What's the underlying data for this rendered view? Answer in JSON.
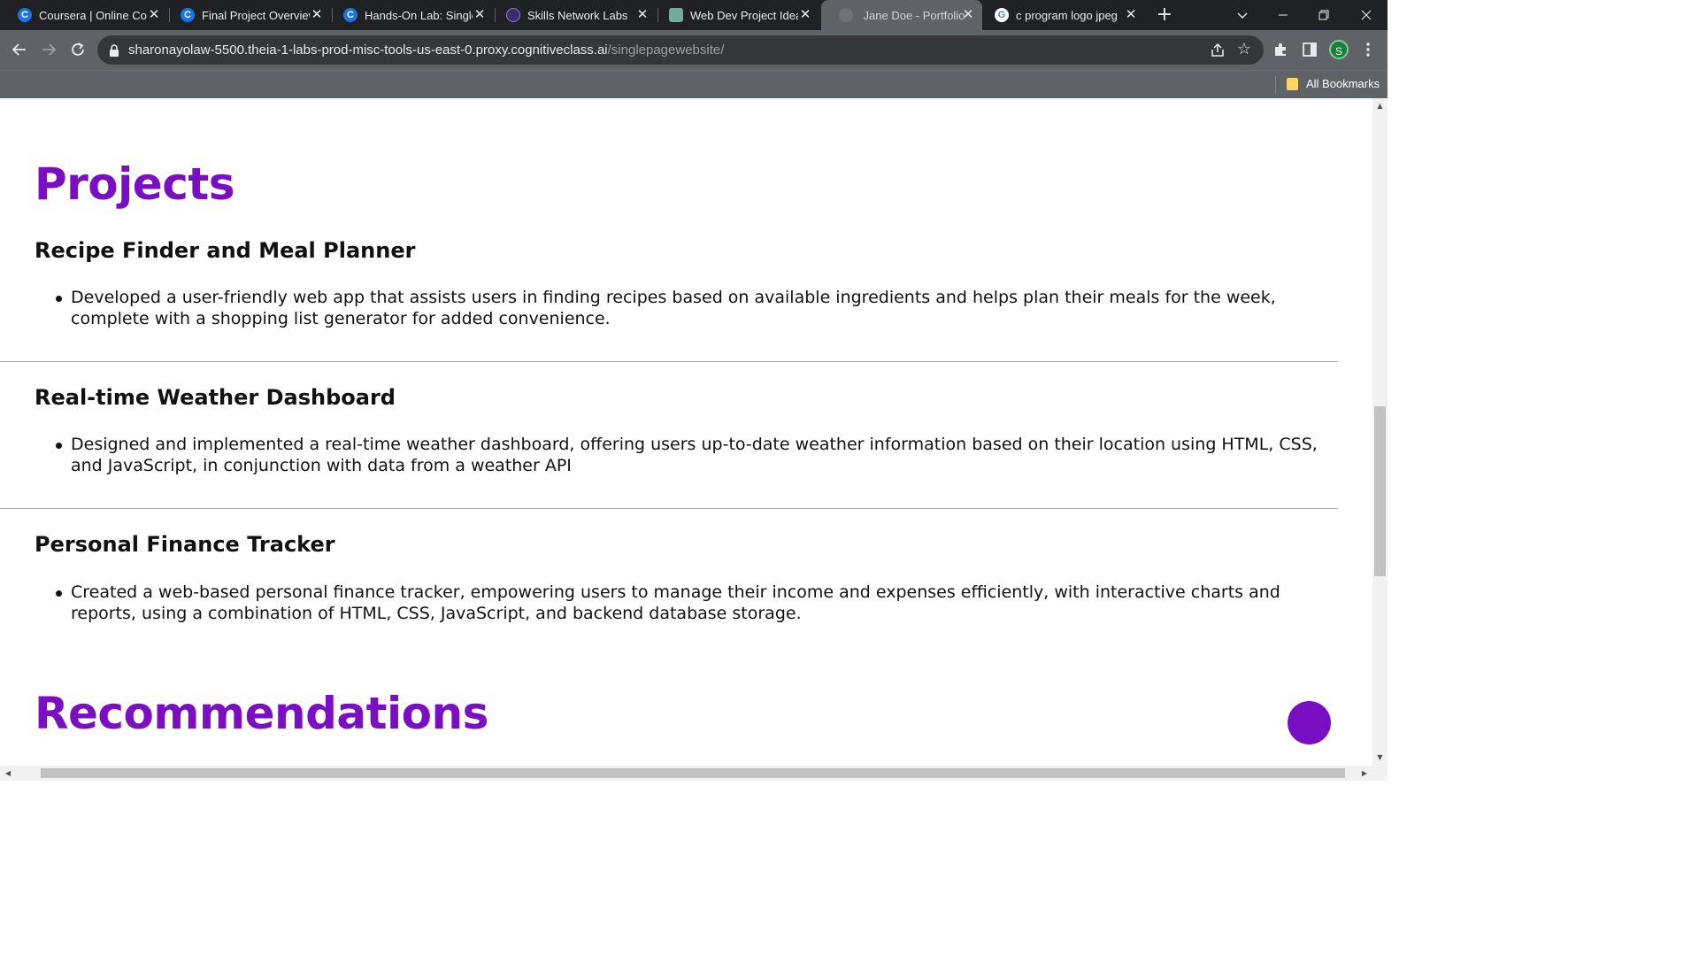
{
  "browser": {
    "tabs": [
      {
        "title": "Coursera | Online Courses",
        "favicon": "coursera-icon"
      },
      {
        "title": "Final Project Overview",
        "favicon": "coursera-icon"
      },
      {
        "title": "Hands-On Lab: Single",
        "favicon": "coursera-icon"
      },
      {
        "title": "Skills Network Labs",
        "favicon": "skills-network-icon"
      },
      {
        "title": "Web Dev Project Ideas",
        "favicon": "chatgpt-icon"
      },
      {
        "title": "Jane Doe - Portfolio",
        "favicon": "globe-icon",
        "active": true
      },
      {
        "title": "c program logo jpeg",
        "favicon": "google-icon"
      }
    ],
    "url": {
      "host": "sharonayolaw-5500.theia-1-labs-prod-misc-tools-us-east-0.proxy.cognitiveclass.ai",
      "path": "/singlepagewebsite/"
    },
    "profile_initial": "S",
    "bookmarks_label": "All Bookmarks"
  },
  "page": {
    "projects_heading": "Projects",
    "projects": [
      {
        "title": "Recipe Finder and Meal Planner",
        "description": "Developed a user-friendly web app that assists users in finding recipes based on available ingredients and helps plan their meals for the week, complete with a shopping list generator for added convenience."
      },
      {
        "title": "Real-time Weather Dashboard",
        "description": "Designed and implemented a real-time weather dashboard, offering users up-to-date weather information based on their location using HTML, CSS, and JavaScript, in conjunction with data from a weather API"
      },
      {
        "title": "Personal Finance Tracker",
        "description": "Created a web-based personal finance tracker, empowering users to manage their income and expenses efficiently, with interactive charts and reports, using a combination of HTML, CSS, JavaScript, and backend database storage."
      }
    ],
    "recommendations_heading": "Recommendations"
  },
  "colors": {
    "accent": "#7a0ec2",
    "chrome_dark": "#202124",
    "chrome_toolbar": "#5f6368"
  }
}
